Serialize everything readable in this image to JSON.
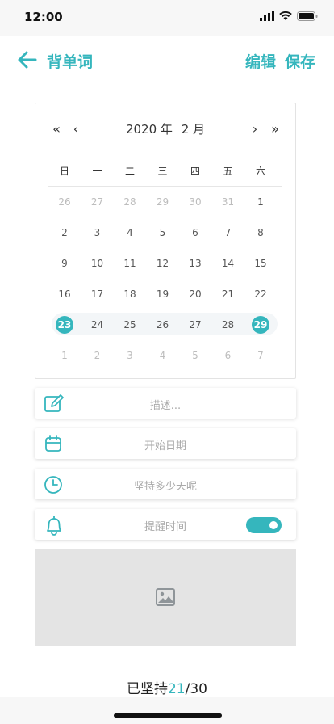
{
  "status_bar": {
    "time": "12:00",
    "icons": [
      "signal-icon",
      "wifi-icon",
      "battery-icon"
    ]
  },
  "nav": {
    "title": "背单词",
    "edit_label": "编辑",
    "save_label": "保存"
  },
  "calendar": {
    "prev_year": "«",
    "prev_month": "‹",
    "next_month": "›",
    "next_year": "»",
    "year": "2020 年",
    "month": "2 月",
    "weekdays": [
      "日",
      "一",
      "二",
      "三",
      "四",
      "五",
      "六"
    ],
    "weeks": [
      [
        {
          "d": "26",
          "dim": true
        },
        {
          "d": "27",
          "dim": true
        },
        {
          "d": "28",
          "dim": true
        },
        {
          "d": "29",
          "dim": true
        },
        {
          "d": "30",
          "dim": true
        },
        {
          "d": "31",
          "dim": true
        },
        {
          "d": "1"
        }
      ],
      [
        {
          "d": "2"
        },
        {
          "d": "3"
        },
        {
          "d": "4"
        },
        {
          "d": "5"
        },
        {
          "d": "6"
        },
        {
          "d": "7"
        },
        {
          "d": "8"
        }
      ],
      [
        {
          "d": "9"
        },
        {
          "d": "10"
        },
        {
          "d": "11"
        },
        {
          "d": "12"
        },
        {
          "d": "13"
        },
        {
          "d": "14"
        },
        {
          "d": "15"
        }
      ],
      [
        {
          "d": "16"
        },
        {
          "d": "17"
        },
        {
          "d": "18"
        },
        {
          "d": "19"
        },
        {
          "d": "20"
        },
        {
          "d": "21"
        },
        {
          "d": "22"
        }
      ],
      [
        {
          "d": "23",
          "sel": true
        },
        {
          "d": "24"
        },
        {
          "d": "25"
        },
        {
          "d": "26"
        },
        {
          "d": "27"
        },
        {
          "d": "28"
        },
        {
          "d": "29",
          "sel": true
        }
      ],
      [
        {
          "d": "1",
          "dim": true
        },
        {
          "d": "2",
          "dim": true
        },
        {
          "d": "3",
          "dim": true
        },
        {
          "d": "4",
          "dim": true
        },
        {
          "d": "5",
          "dim": true
        },
        {
          "d": "6",
          "dim": true
        },
        {
          "d": "7",
          "dim": true
        }
      ]
    ]
  },
  "fields": {
    "description_placeholder": "描述...",
    "start_date_placeholder": "开始日期",
    "duration_placeholder": "坚持多少天呢",
    "reminder_label": "提醒时间",
    "reminder_enabled": true
  },
  "progress": {
    "prefix": "已坚持",
    "current": "21",
    "separator": "/",
    "total": "30"
  },
  "colors": {
    "accent": "#35b6bd",
    "muted": "#a9a9a9",
    "image_bg": "#e4e4e4"
  }
}
